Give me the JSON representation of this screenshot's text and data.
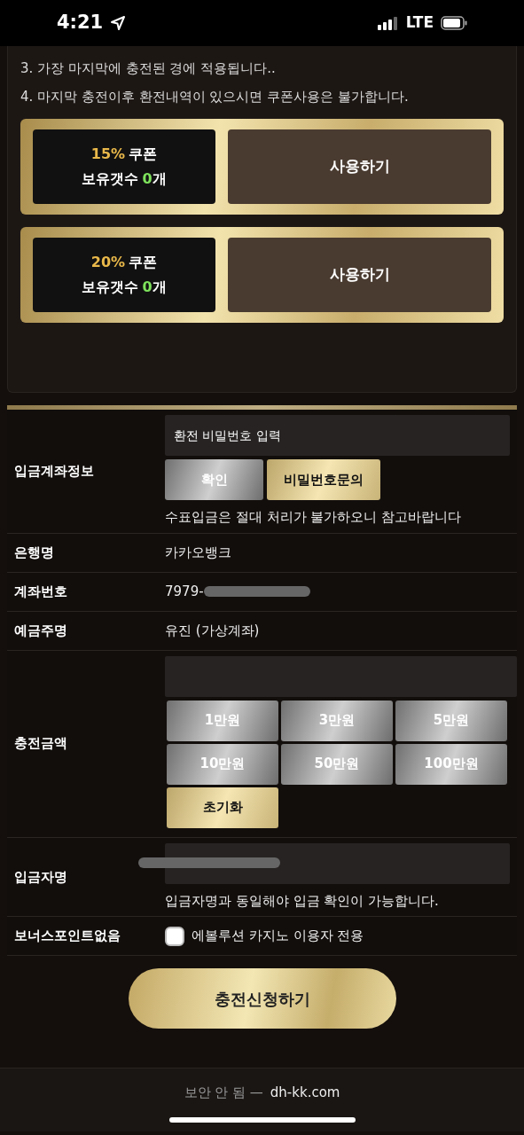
{
  "status_bar": {
    "time": "4:21",
    "network": "LTE"
  },
  "notes": [
    "3. 가장 마지막에 충전된 경에 적용됩니다..",
    "4. 마지막 충전이후 환전내역이 있으시면 쿠폰사용은 불가합니다."
  ],
  "coupons": [
    {
      "percent": "15%",
      "label": "쿠폰",
      "count_label": "보유갯수",
      "count": "0",
      "unit": "개",
      "button": "사용하기"
    },
    {
      "percent": "20%",
      "label": "쿠폰",
      "count_label": "보유갯수",
      "count": "0",
      "unit": "개",
      "button": "사용하기"
    }
  ],
  "form": {
    "account_info": {
      "label": "입금계좌정보",
      "password_placeholder": "환전 비밀번호 입력",
      "confirm_button": "확인",
      "inquiry_button": "비밀번호문의",
      "note": "수표입금은 절대 처리가 불가하오니 참고바랍니다"
    },
    "rows": [
      {
        "label": "은행명",
        "value": "카카오뱅크",
        "redacted": false
      },
      {
        "label": "계좌번호",
        "value": "7979-",
        "redacted": true
      },
      {
        "label": "예금주명",
        "value": "유진 (가상계좌)",
        "redacted": false
      }
    ],
    "amount": {
      "label": "충전금액",
      "buttons": [
        "1만원",
        "3만원",
        "5만원",
        "10만원",
        "50만원",
        "100만원"
      ],
      "reset_button": "초기화"
    },
    "depositor": {
      "label": "입금자명",
      "redacted": true,
      "note": "입금자명과 동일해야 입금 확인이 가능합니다."
    },
    "bonus": {
      "label": "보너스포인트없음",
      "checked": false,
      "option": "에볼루션 카지노 이용자 전용"
    }
  },
  "submit_button": "충전신청하기",
  "browser_bar": {
    "security": "보안 안 됨 —",
    "url": "dh-kk.com"
  }
}
